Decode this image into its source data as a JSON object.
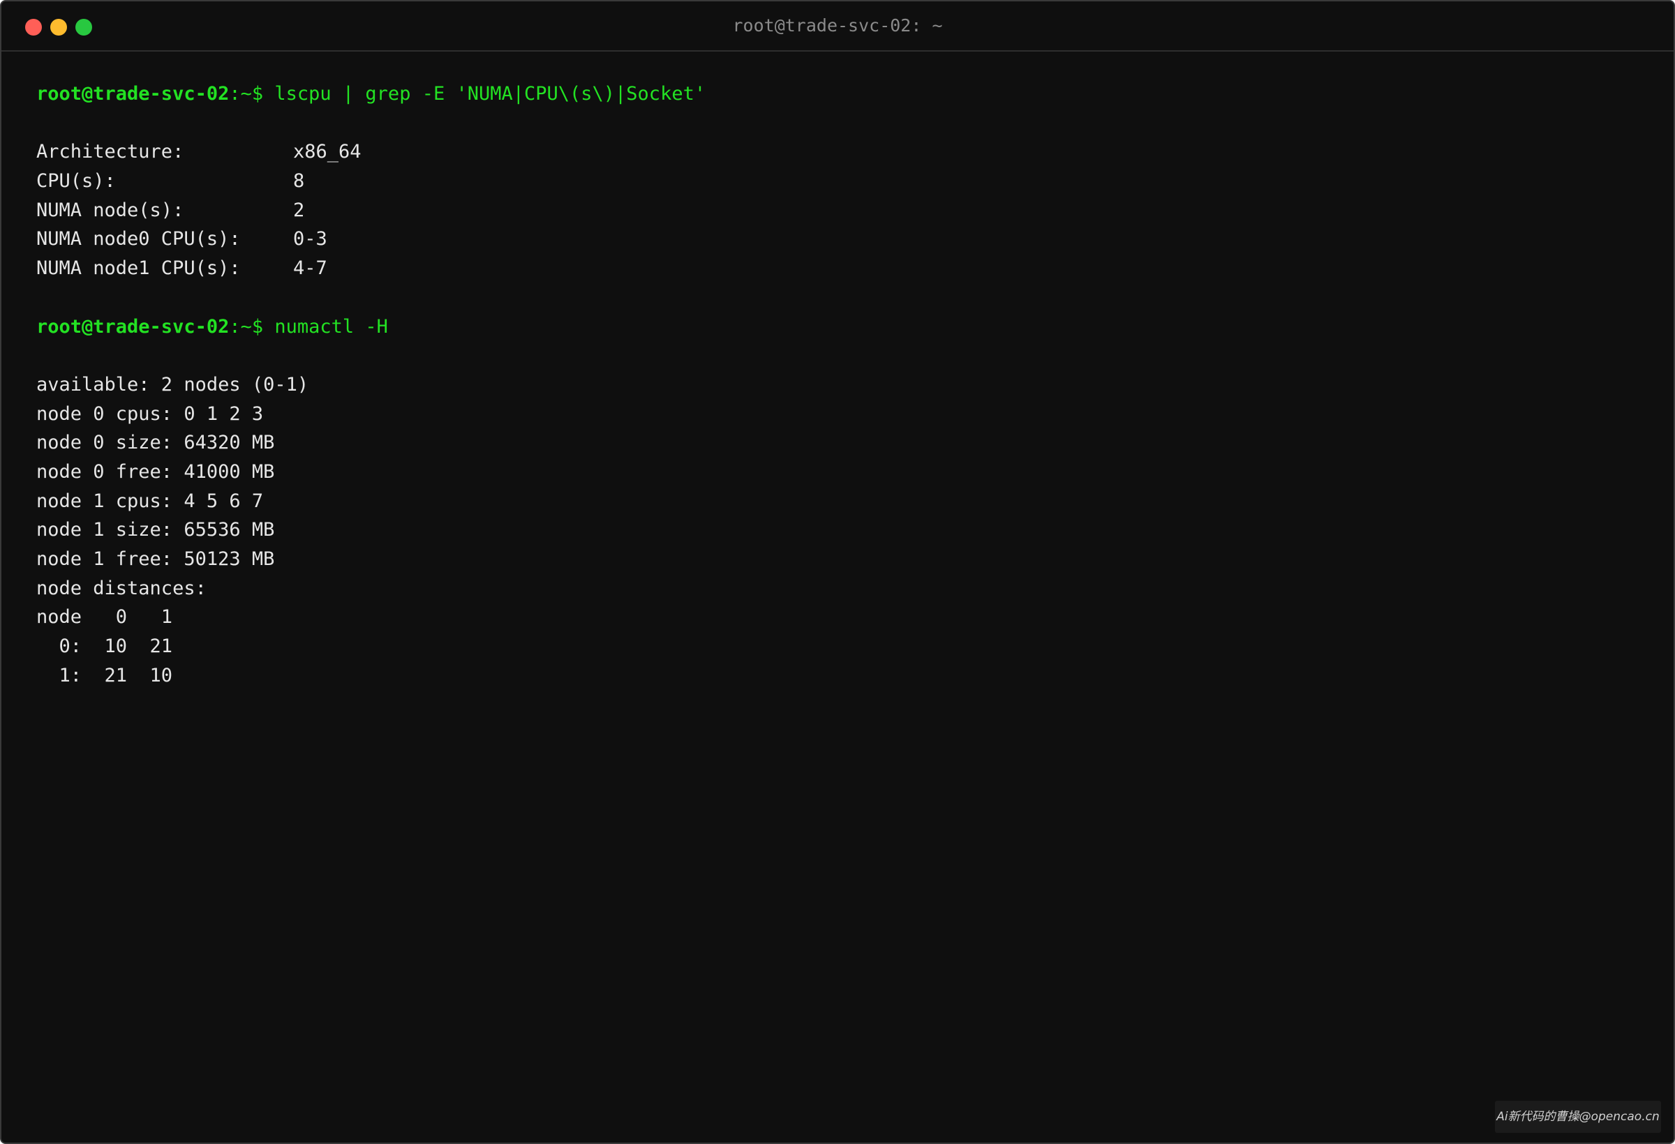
{
  "window": {
    "title": "root@trade-svc-02: ~"
  },
  "terminal": {
    "prompt_user_host": "root@trade-svc-02",
    "prompt_path": ":~$",
    "command1": " lscpu | grep -E 'NUMA|CPU\\(s\\)|Socket'",
    "lscpu": [
      {
        "key": "Architecture:",
        "value": "x86_64"
      },
      {
        "key": "CPU(s):",
        "value": "8"
      },
      {
        "key": "NUMA node(s):",
        "value": "2"
      },
      {
        "key": "NUMA node0 CPU(s):",
        "value": "0-3"
      },
      {
        "key": "NUMA node1 CPU(s):",
        "value": "4-7"
      }
    ],
    "command2": " numactl -H",
    "numactl": [
      "available: 2 nodes (0-1)",
      "node 0 cpus: 0 1 2 3",
      "node 0 size: 64320 MB",
      "node 0 free: 41000 MB",
      "node 1 cpus: 4 5 6 7",
      "node 1 size: 65536 MB",
      "node 1 free: 50123 MB",
      "node distances:",
      "node   0   1",
      "  0:  10  21",
      "  1:  21  10"
    ]
  },
  "watermark": "Ai新代码的曹操@opencao.cn",
  "colors": {
    "background": "#0f0f0f",
    "prompt_green": "#23e223",
    "text": "#e6e6e6",
    "close": "#ff5f57",
    "minimize": "#febc2e",
    "maximize": "#28c840"
  }
}
